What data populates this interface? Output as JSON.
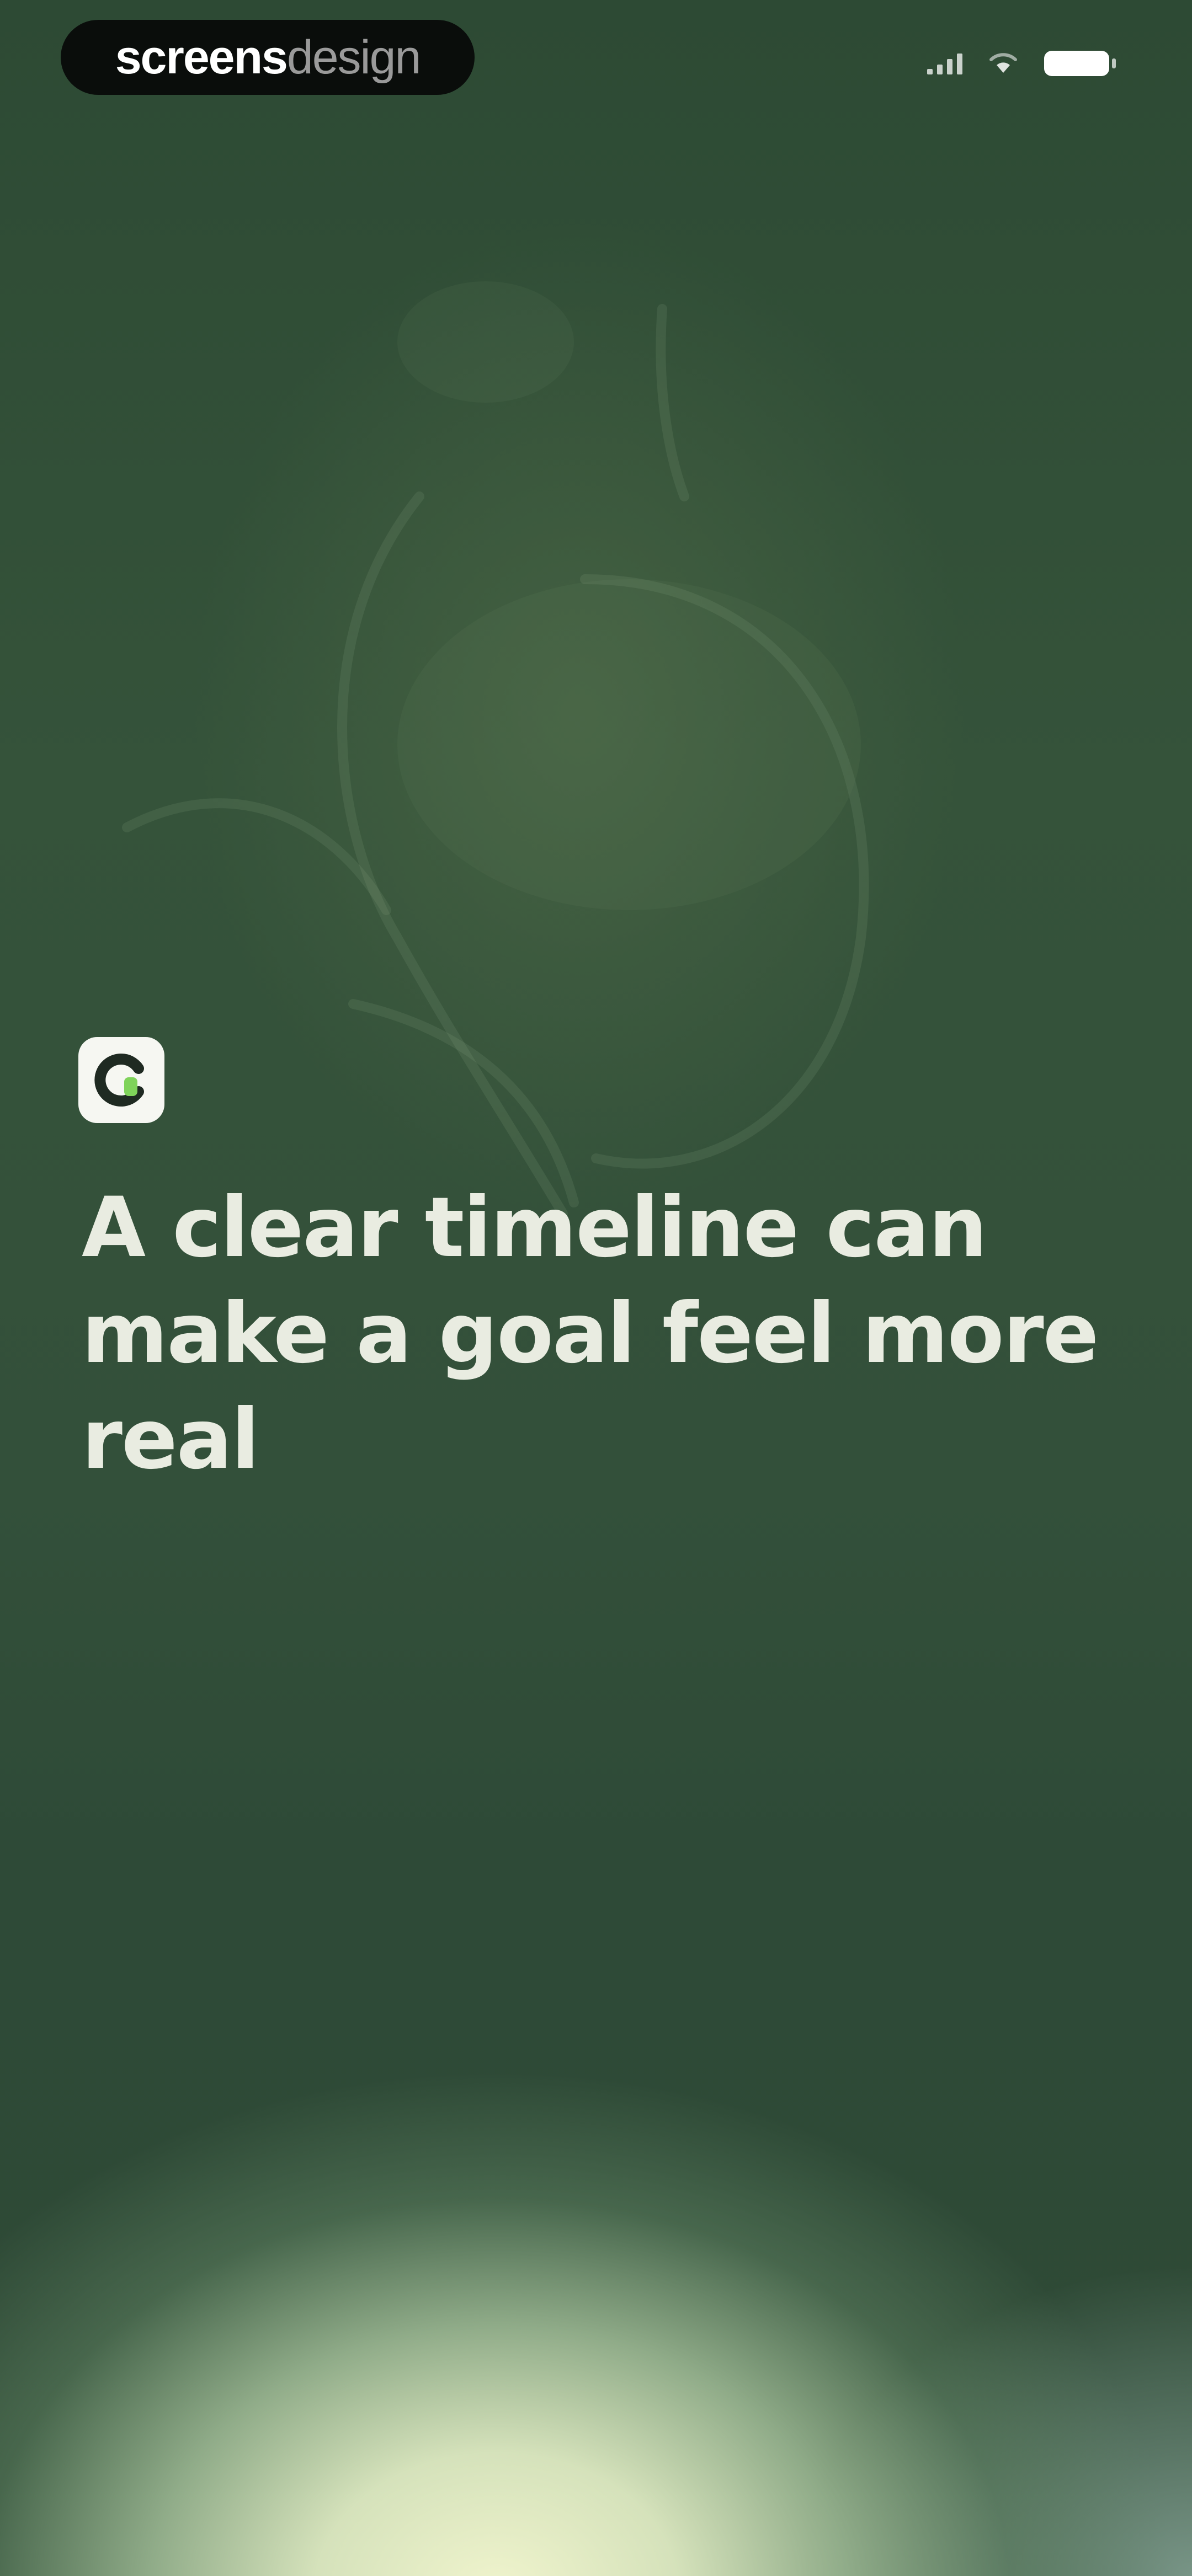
{
  "watermark": {
    "bold": "screens",
    "light": "design"
  },
  "status_bar": {
    "icons": [
      "signal-icon",
      "wifi-icon",
      "battery-icon"
    ]
  },
  "app": {
    "icon": "app-logo-icon",
    "accent": "#7fd35a"
  },
  "onboarding": {
    "headline": "A clear timeline can make a goal feel more real"
  },
  "colors": {
    "background_top": "#2d4a34",
    "background_glow": "#eef2cc",
    "headline": "#e9ece1"
  }
}
